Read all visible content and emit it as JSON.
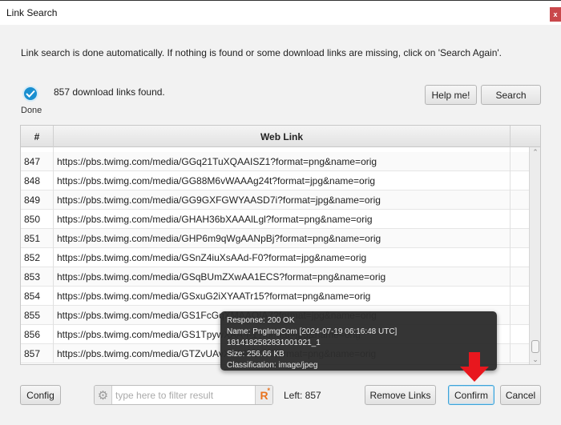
{
  "window": {
    "title": "Link Search",
    "close_label": "x"
  },
  "intro_text": "Link search is done automatically. If nothing is found or some download links are missing, click on 'Search Again'.",
  "status": {
    "icon": "check-circle-icon",
    "label": "Done",
    "message": "857 download links found."
  },
  "buttons": {
    "help": "Help me!",
    "search": "Search",
    "config": "Config",
    "remove_links": "Remove Links",
    "confirm": "Confirm",
    "cancel": "Cancel"
  },
  "table": {
    "columns": [
      "#",
      "Web Link",
      ""
    ],
    "rows": [
      {
        "num": "847",
        "link": "https://pbs.twimg.com/media/GGq21TuXQAAISZ1?format=png&name=orig"
      },
      {
        "num": "848",
        "link": "https://pbs.twimg.com/media/GG88M6vWAAAg24t?format=jpg&name=orig"
      },
      {
        "num": "849",
        "link": "https://pbs.twimg.com/media/GG9GXFGWYAASD7i?format=jpg&name=orig"
      },
      {
        "num": "850",
        "link": "https://pbs.twimg.com/media/GHAH36bXAAAlLgl?format=png&name=orig"
      },
      {
        "num": "851",
        "link": "https://pbs.twimg.com/media/GHP6m9qWgAANpBj?format=png&name=orig"
      },
      {
        "num": "852",
        "link": "https://pbs.twimg.com/media/GSnZ4iuXsAAd-F0?format=jpg&name=orig"
      },
      {
        "num": "853",
        "link": "https://pbs.twimg.com/media/GSqBUmZXwAA1ECS?format=png&name=orig"
      },
      {
        "num": "854",
        "link": "https://pbs.twimg.com/media/GSxuG2iXYAATr15?format=png&name=orig"
      },
      {
        "num": "855",
        "link": "https://pbs.twimg.com/media/GS1FcGqXMAAQIA7?format=jpg&name=orig"
      },
      {
        "num": "856",
        "link": "https://pbs.twimg.com/media/GS1TpywXAA-f-1?format=jpg&name=orig"
      },
      {
        "num": "857",
        "link": "https://pbs.twimg.com/media/GTZvUAvXYAAYLGI?format=png&name=orig"
      }
    ]
  },
  "tooltip": {
    "response": "Response: 200 OK",
    "name": "Name: PngImgCom [2024-07-19 06:16:48 UTC] 1814182582831001921_1",
    "size": "Size: 256.66 KB",
    "classification": "Classification: image/jpeg"
  },
  "filter": {
    "placeholder": "type here to filter result",
    "value": "",
    "regex_label": "R",
    "regex_mark": "*"
  },
  "left_count": "Left: 857",
  "colors": {
    "accent": "#1a8fd0",
    "close": "#c9484b",
    "arrow": "#e8171e",
    "regex": "#e8731f"
  }
}
